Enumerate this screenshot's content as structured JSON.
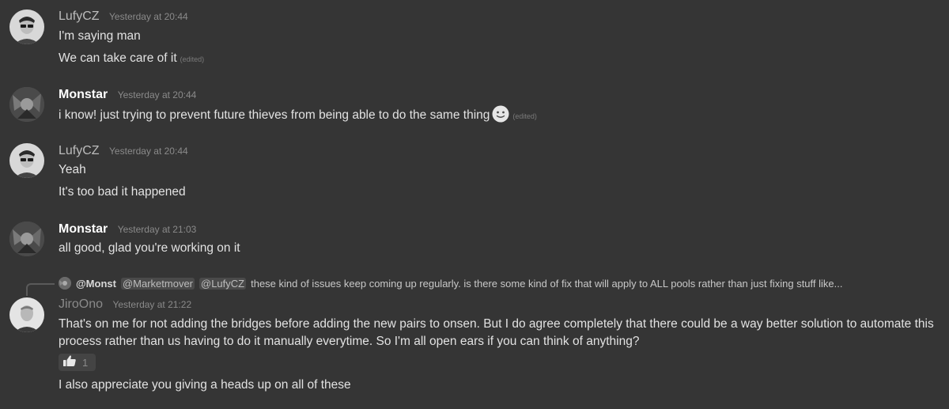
{
  "messages": [
    {
      "username": "LufyCZ",
      "timestamp": "Yesterday at 20:44",
      "lines": [
        "I'm saying man",
        "We can take care of it"
      ],
      "edited_label": "(edited)"
    },
    {
      "username": "Monstar",
      "timestamp": "Yesterday at 20:44",
      "lines": [
        "i know! just trying to prevent future thieves from being able to do the same thing"
      ],
      "emoji": "slightly-smiling-face",
      "edited_label": "(edited)"
    },
    {
      "username": "LufyCZ",
      "timestamp": "Yesterday at 20:44",
      "lines": [
        "Yeah",
        "It's too bad it happened"
      ]
    },
    {
      "username": "Monstar",
      "timestamp": "Yesterday at 21:03",
      "lines": [
        "all good, glad you're working on it"
      ]
    },
    {
      "reply": {
        "author": "@Monst",
        "mentions": [
          "@Marketmover",
          "@LufyCZ"
        ],
        "text": "these kind of issues keep coming up regularly. is there some kind of fix that will apply to ALL pools rather than just fixing stuff like..."
      },
      "username": "JiroOno",
      "timestamp": "Yesterday at 21:22",
      "paragraph": "That's on me for not adding the bridges before adding the new pairs to onsen. But I do agree completely that there could be a way better solution to automate this process rather than us having to do it manually everytime. So I'm all open ears if you can think of anything?",
      "reaction": {
        "emoji": "thumbs-up",
        "count": "1"
      },
      "followup": "I also appreciate you giving a heads up on all of these"
    }
  ]
}
